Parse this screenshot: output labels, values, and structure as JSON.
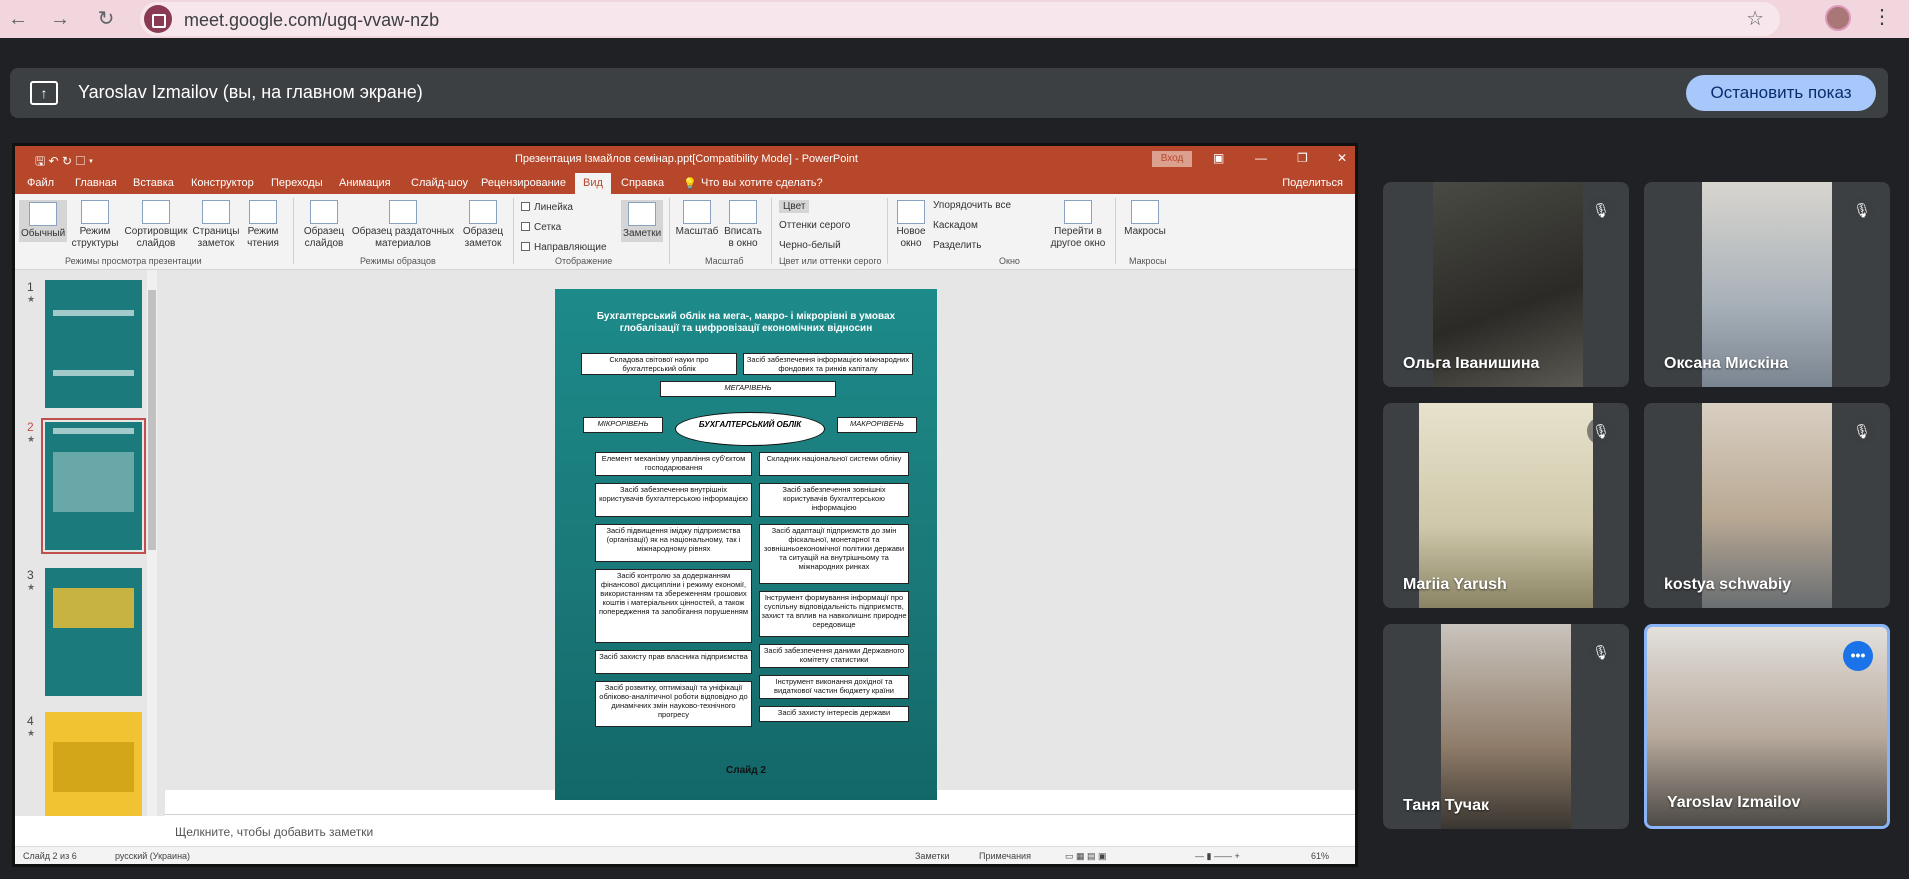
{
  "browser": {
    "url": "meet.google.com/ugq-vvaw-nzb",
    "back_icon": "←",
    "forward_icon": "→",
    "reload_icon": "↻",
    "star_icon": "☆",
    "menu_icon": "⋮"
  },
  "banner": {
    "text": "Yaroslav Izmailov (вы, на главном экране)",
    "stop_label": "Остановить показ"
  },
  "powerpoint": {
    "window_title": "Презентация Ізмайлов семінар.ppt[Compatibility Mode]  -  PowerPoint",
    "login_label": "Вход",
    "menu": [
      "Файл",
      "Главная",
      "Вставка",
      "Конструктор",
      "Переходы",
      "Анимация",
      "Слайд-шоу",
      "Рецензирование",
      "Вид",
      "Справка"
    ],
    "tell_me": "Что вы хотите сделать?",
    "share": "Поделиться",
    "ribbon": {
      "view_normal": "Обычный",
      "view_outline": "Режим структуры",
      "view_sorter": "Сортировщик слайдов",
      "view_notes": "Страницы заметок",
      "view_reading": "Режим чтения",
      "group_views": "Режимы просмотра презентации",
      "master_slide": "Образец слайдов",
      "master_handout": "Образец раздаточных материалов",
      "master_notes": "Образец заметок",
      "group_masters": "Режимы образцов",
      "ruler": "Линейка",
      "grid": "Сетка",
      "guides": "Направляющие",
      "notes_btn": "Заметки",
      "group_show": "Отображение",
      "zoom": "Масштаб",
      "fit": "Вписать в окно",
      "group_zoom": "Масштаб",
      "color": "Цвет",
      "grayscale": "Оттенки серого",
      "bw": "Черно-белый",
      "group_color": "Цвет или оттенки серого",
      "new_window": "Новое окно",
      "arrange_all": "Упорядочить все",
      "cascade": "Каскадом",
      "split": "Разделить",
      "switch_window": "Перейти в другое окно",
      "group_window": "Окно",
      "macros": "Макросы",
      "group_macros": "Макросы"
    },
    "thumb_numbers": [
      "1",
      "2",
      "3",
      "4"
    ],
    "notes_placeholder": "Щелкните, чтобы добавить заметки",
    "status": {
      "slide_of": "Слайд 2 из 6",
      "language": "русский (Украина)",
      "notes": "Заметки",
      "comments": "Примечания",
      "zoom": "61%"
    },
    "slide": {
      "title": "Бухгалтерський облік на мега-, макро- і мікрорівні в умовах глобалізації та цифровізації економічних відносин",
      "top_left": "Складова світової науки про бухгалтерський облік",
      "top_right": "Засіб забезпечення інформацією міжнародних фондових та ринків капіталу",
      "mega": "МЕГАРІВЕНЬ",
      "micro": "МІКРОРІВЕНЬ",
      "macro": "МАКРОРІВЕНЬ",
      "center": "БУХГАЛТЕРСЬКИЙ ОБЛІК",
      "left_boxes": [
        "Елемент механізму управління суб'єктом господарювання",
        "Засіб забезпечення внутрішніх користувачів бухгалтерською інформацією",
        "Засіб підвищення іміджу підприємства (організації) як на національному, так і міжнародному рівнях",
        "Засіб контролю за додержанням фінансової дисципліни і режиму економії, використанням та збереженням грошових коштів і матеріальних цінностей, а також попередження та запобігання порушенням",
        "Засіб захисту прав власника підприємства",
        "Засіб розвитку, оптимізації та уніфікації обліково-аналітичної роботи відповідно до динамічних змін науково-технічного прогресу"
      ],
      "right_boxes": [
        "Складник національної системи обліку",
        "Засіб забезпечення зовнішніх користувачів бухгалтерською інформацією",
        "Засіб адаптації підприємств до змін фіскальної, монетарної та зовнішньоекономічної політики держави та ситуацій на внутрішньому та міжнародних ринках",
        "Інструмент формування інформації про суспільну відповідальність підприємств, захист та вплив на навколишнє природне середовище",
        "Засіб забезпечення даними Державного комітету статистики",
        "Інструмент виконання дохідної та видаткової частин бюджету країни",
        "Засіб захисту інтересів держави"
      ],
      "footer": "Слайд 2"
    }
  },
  "participants": [
    {
      "name": "Ольга Іванишина",
      "muted": true
    },
    {
      "name": "Оксана Мискіна",
      "muted": true
    },
    {
      "name": "Mariia Yarush",
      "muted": true
    },
    {
      "name": "kostya schwabiy",
      "muted": true
    },
    {
      "name": "Таня Тучак",
      "muted": true
    },
    {
      "name": "Yaroslav Izmailov",
      "muted": false
    }
  ],
  "icons": {
    "mic_off": "🎙",
    "more": "•••"
  },
  "colors": {
    "ppt_red": "#b7472a",
    "meet_blue": "#a8c7fa",
    "slide_teal": "#1a7777"
  }
}
